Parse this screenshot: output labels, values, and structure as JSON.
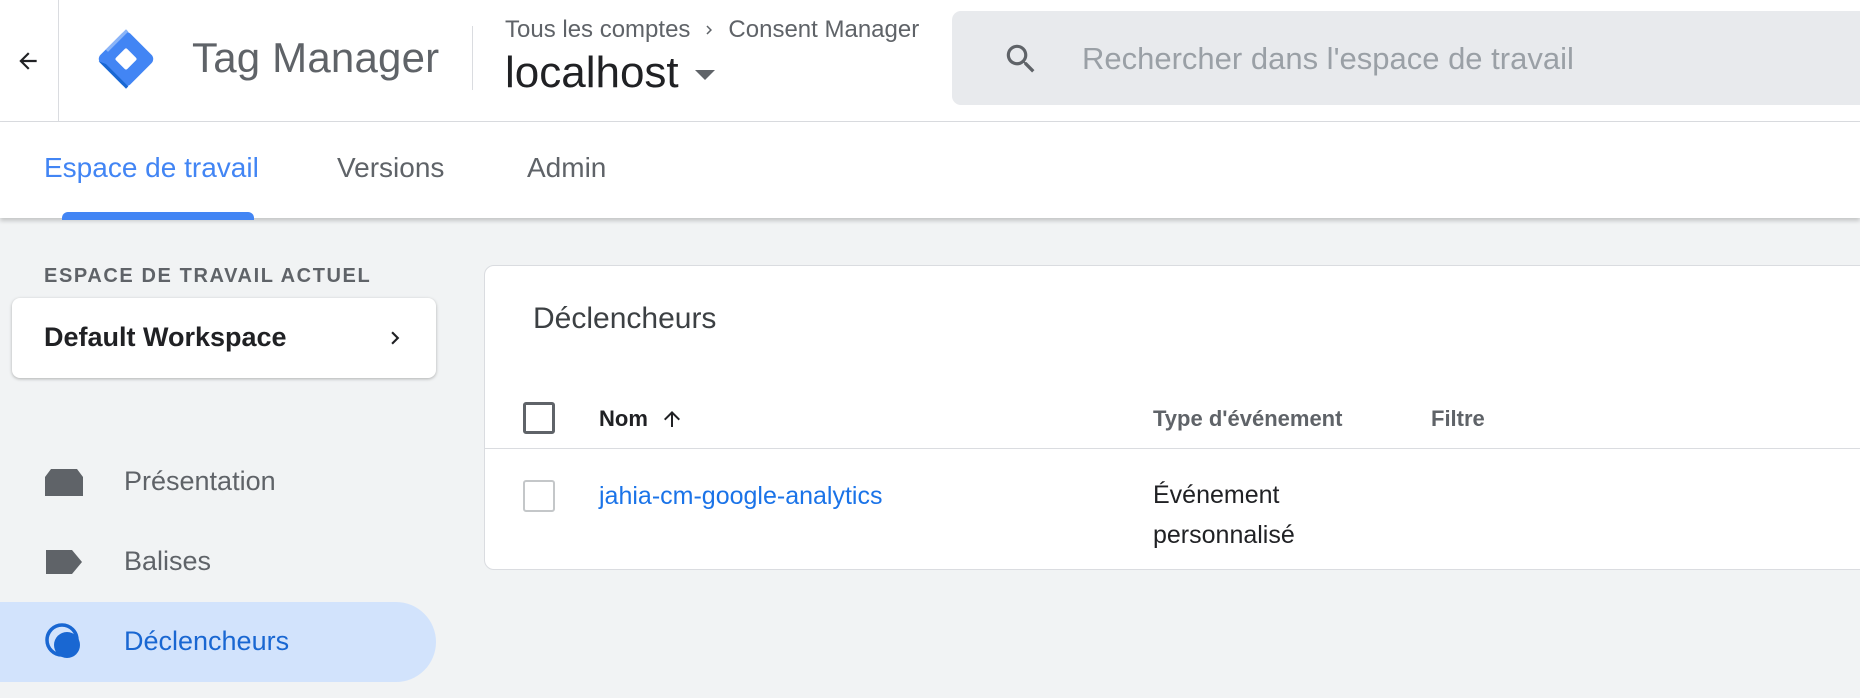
{
  "header": {
    "product_name": "Tag Manager",
    "breadcrumb": {
      "account": "Tous les comptes",
      "container_group": "Consent Manager"
    },
    "container": "localhost",
    "search": {
      "placeholder": "Rechercher dans l'espace de travail",
      "value": ""
    },
    "colors": {
      "logo_blue": "#4285f4",
      "logo_dark": "#1967d2",
      "accent": "#4285f4"
    }
  },
  "tabs": [
    {
      "label": "Espace de travail",
      "active": true
    },
    {
      "label": "Versions",
      "active": false
    },
    {
      "label": "Admin",
      "active": false
    }
  ],
  "sidebar": {
    "workspace_label": "ESPACE DE TRAVAIL ACTUEL",
    "workspace_name": "Default Workspace",
    "items": [
      {
        "label": "Présentation",
        "icon": "overview-icon",
        "active": false
      },
      {
        "label": "Balises",
        "icon": "tag-icon",
        "active": false
      },
      {
        "label": "Déclencheurs",
        "icon": "trigger-icon",
        "active": true
      }
    ],
    "colors": {
      "active_bg": "#d2e3fc",
      "active_text": "#1967d2"
    }
  },
  "main": {
    "title": "Déclencheurs",
    "columns": {
      "name": "Nom",
      "name_sort": "ascending",
      "event_type": "Type d'événement",
      "filter": "Filtre"
    },
    "rows": [
      {
        "name": "jahia-cm-google-analytics",
        "event_type": "Événement personnalisé",
        "filter": "",
        "checked": false
      }
    ]
  }
}
